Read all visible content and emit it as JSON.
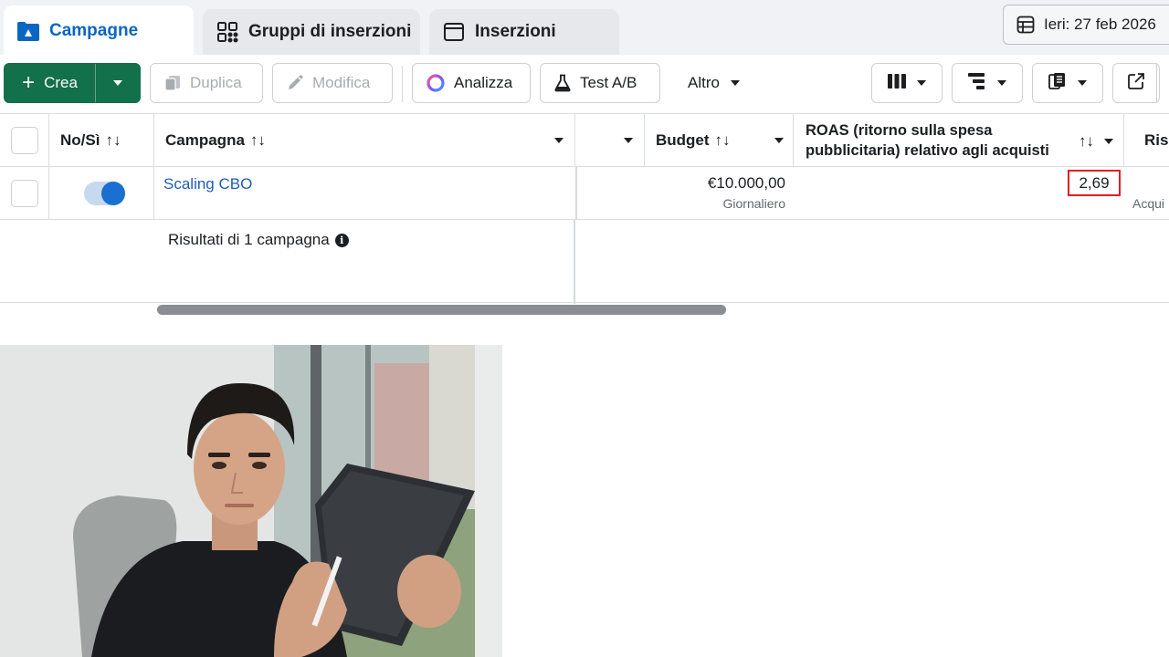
{
  "tabs": [
    {
      "label": "Campagne",
      "icon": "campaign-folder-icon",
      "active": true
    },
    {
      "label": "Gruppi di inserzioni",
      "icon": "grid-icon",
      "active": false
    },
    {
      "label": "Inserzioni",
      "icon": "ad-window-icon",
      "active": false
    }
  ],
  "date_picker": {
    "label": "Ieri: 27 feb 2026",
    "icon": "calendar-table-icon"
  },
  "toolbar": {
    "create_label": "Crea",
    "duplicate_label": "Duplica",
    "edit_label": "Modifica",
    "analyze_label": "Analizza",
    "abtest_label": "Test A/B",
    "more_label": "Altro"
  },
  "table": {
    "headers": {
      "toggle": "No/Sì",
      "campaign": "Campagna",
      "budget": "Budget",
      "roas": "ROAS (ritorno sulla spesa pubblicitaria) relativo agli acquisti",
      "results": "Risu"
    },
    "rows": [
      {
        "active": true,
        "campaign": "Scaling CBO",
        "budget": "€10.000,00",
        "budget_type": "Giornaliero",
        "roas": "2,69",
        "results_sub": "Acqui"
      }
    ],
    "summary": "Risultati di 1 campagna"
  },
  "colors": {
    "brand_blue": "#0a66c2",
    "create_green": "#12704a",
    "highlight_red": "#e01e26"
  }
}
